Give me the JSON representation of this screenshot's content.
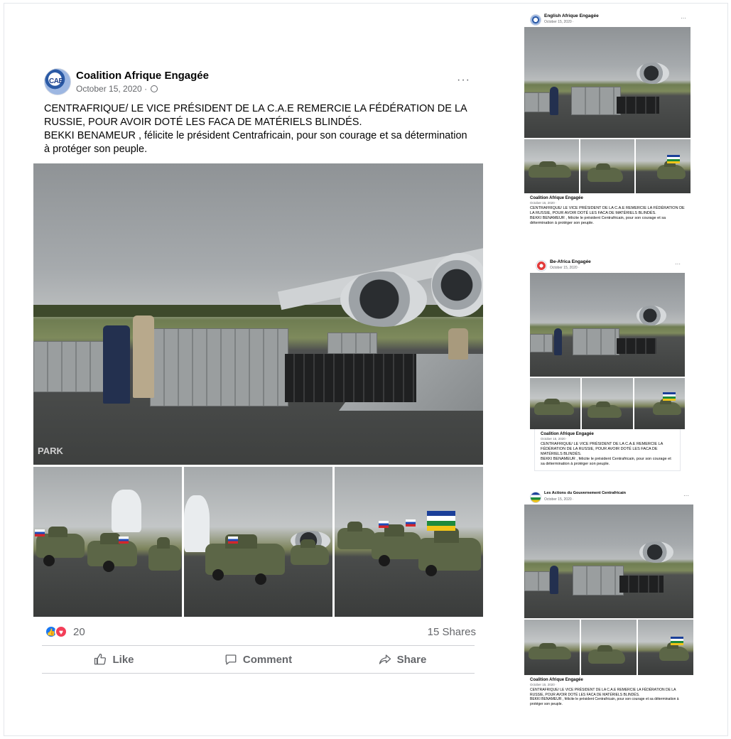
{
  "main_post": {
    "page_name": "Coalition Afrique Engagée",
    "avatar_text": "CAE",
    "date": "October 15, 2020 ·",
    "more": "···",
    "text_line1": "CENTRAFRIQUE/ LE VICE PRÉSIDENT DE LA C.A.E REMERCIE LA FÉDÉRATION DE LA RUSSIE, POUR AVOIR DOTÉ LES FACA DE MATÉRIELS BLINDÉS.",
    "text_line2": "BEKKI BENAMEUR , félicite le président Centrafricain, pour son courage et sa détermination à protéger son peuple.",
    "photo_watermark": "PARK",
    "reaction_count": "20",
    "shares": "15 Shares",
    "actions": {
      "like": "Like",
      "comment": "Comment",
      "share": "Share"
    }
  },
  "mini_posts": [
    {
      "page_name": "English Afrique Engagée",
      "date": "October 15, 2020 ·",
      "more": "···",
      "shared_name": "Coalition Afrique Engagée",
      "shared_date": "October 15, 2020 ·",
      "text_line1": "CENTRAFRIQUE/ LE VICE PRÉSIDENT DE LA C.A.E REMERCIE LA FÉDÉRATION DE LA RUSSIE, POUR AVOIR DOTÉ LES FACA DE MATÉRIELS BLINDÉS.",
      "text_line2": "BEKKI BENAMEUR , félicite le président Centrafricain, pour son courage et sa détermination à protéger son peuple."
    },
    {
      "page_name": "Be-Africa Engagée",
      "date": "October 15, 2020 ·",
      "more": "···",
      "shared_name": "Coalition Afrique Engagée",
      "shared_date": "October 15, 2020 ·",
      "text_line1": "CENTRAFRIQUE/ LE VICE PRÉSIDENT DE LA C.A.E REMERCIE LA FÉDÉRATION DE LA RUSSIE, POUR AVOIR DOTÉ LES FACA DE MATÉRIELS BLINDÉS.",
      "text_line2": "BEKKI BENAMEUR , félicite le président Centrafricain, pour son courage et sa détermination à protéger son peuple."
    },
    {
      "page_name": "Les Actions du Gouvernement Centrafricain",
      "date": "October 15, 2020 ·",
      "more": "···",
      "shared_name": "Coalition Afrique Engagée",
      "shared_date": "October 15, 2020 ·",
      "text_line1": "CENTRAFRIQUE/ LE VICE PRÉSIDENT DE LA C.A.E REMERCIE LA FÉDÉRATION DE LA RUSSIE, POUR AVOIR DOTÉ LES FACA DE MATÉRIELS BLINDÉS.",
      "text_line2": "BEKKI BENAMEUR , félicite le président Centrafricain, pour son courage et sa détermination à protéger son peuple."
    }
  ],
  "icons": {
    "like_reaction": "like-icon",
    "love_reaction": "heart-icon",
    "privacy": "globe-icon",
    "like_action": "thumbs-up-icon",
    "comment_action": "comment-bubble-icon",
    "share_action": "share-arrow-icon"
  },
  "colors": {
    "facebook_blue": "#1877f2",
    "love_red": "#f33e58",
    "secondary_text": "#65676b",
    "divider": "#ced0d4"
  }
}
